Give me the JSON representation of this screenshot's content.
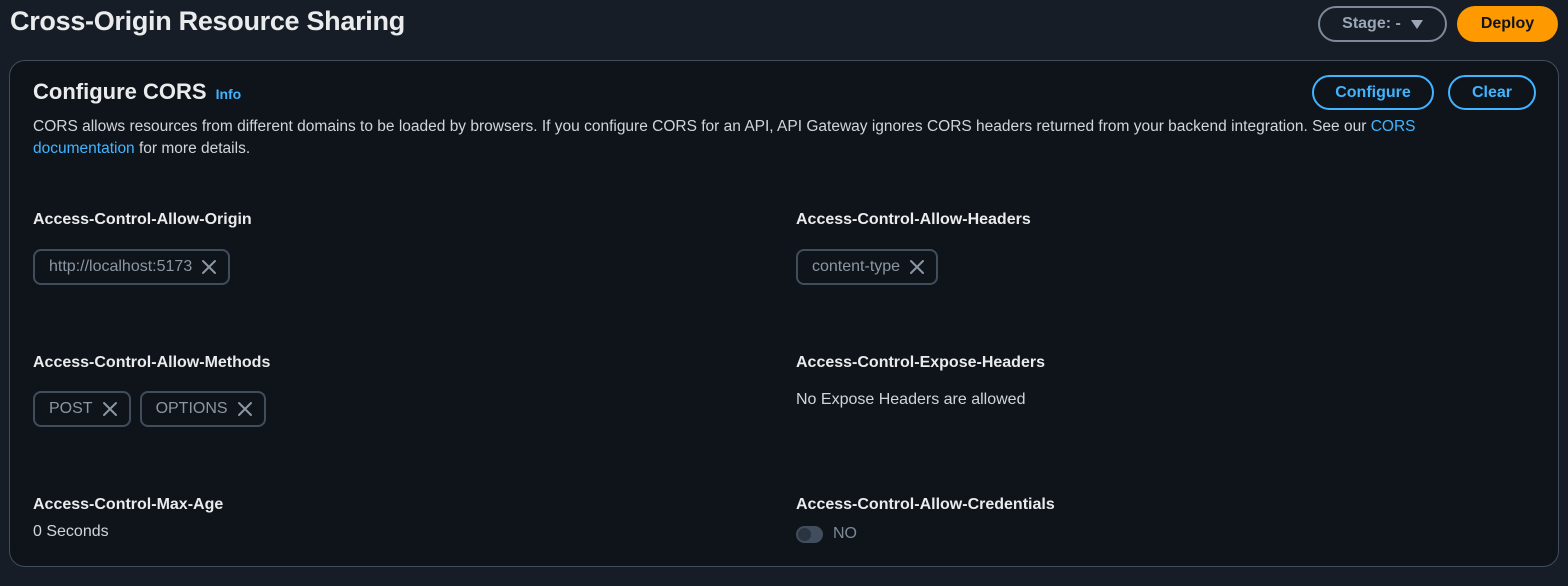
{
  "header": {
    "title": "Cross-Origin Resource Sharing",
    "stage_label": "Stage: -",
    "deploy_label": "Deploy"
  },
  "panel": {
    "title": "Configure CORS",
    "info_label": "Info",
    "configure_label": "Configure",
    "clear_label": "Clear",
    "description_text": "CORS allows resources from different domains to be loaded by browsers. If you configure CORS for an API, API Gateway ignores CORS headers returned from your backend integration. See our",
    "description_link": "CORS documentation",
    "description_suffix": "for more details."
  },
  "fields": {
    "allow_origin": {
      "label": "Access-Control-Allow-Origin",
      "tokens": [
        "http://localhost:5173"
      ]
    },
    "allow_headers": {
      "label": "Access-Control-Allow-Headers",
      "tokens": [
        "content-type"
      ]
    },
    "allow_methods": {
      "label": "Access-Control-Allow-Methods",
      "tokens": [
        "POST",
        "OPTIONS"
      ]
    },
    "expose_headers": {
      "label": "Access-Control-Expose-Headers",
      "value": "No Expose Headers are allowed"
    },
    "max_age": {
      "label": "Access-Control-Max-Age",
      "value": "0 Seconds"
    },
    "allow_credentials": {
      "label": "Access-Control-Allow-Credentials",
      "value": "NO",
      "enabled": false
    }
  },
  "colors": {
    "accent": "#42b4ff",
    "deploy": "#ff9900",
    "background": "#0f141a"
  },
  "icons": {
    "remove_token": "close-icon",
    "stage_dropdown": "caret-down-icon"
  }
}
